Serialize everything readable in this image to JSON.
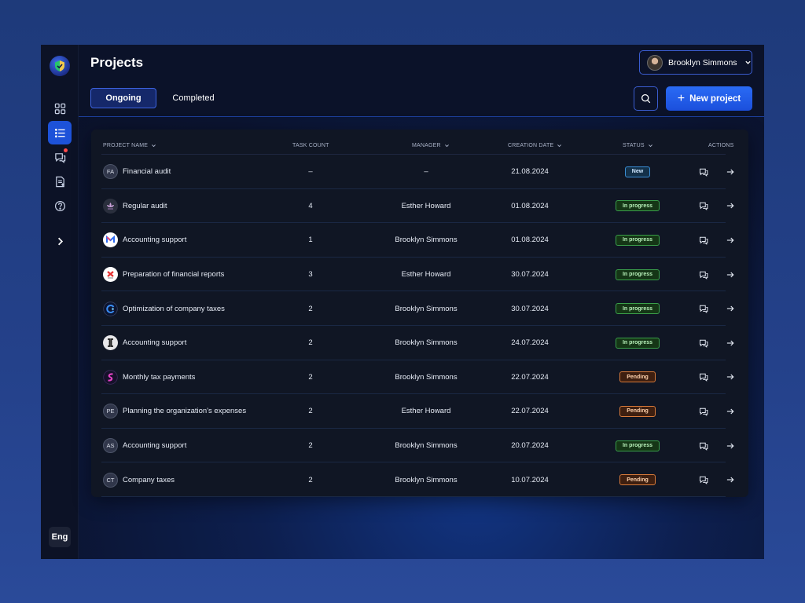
{
  "app": {
    "page_title": "Projects",
    "language": "Eng",
    "user": {
      "name": "Brooklyn Simmons"
    }
  },
  "sidebar": {
    "icons": [
      "dashboard-icon",
      "list-icon",
      "chat-icon",
      "document-add-icon",
      "help-icon",
      "chevron-right-icon"
    ]
  },
  "tabs": [
    {
      "label": "Ongoing",
      "active": true
    },
    {
      "label": "Completed",
      "active": false
    }
  ],
  "toolbar": {
    "new_project_label": "New project"
  },
  "table": {
    "headers": {
      "project_name": "PROJECT NAME",
      "task_count": "TASK COUNT",
      "manager": "MANAGER",
      "creation_date": "CREATION DATE",
      "status": "STATUS",
      "actions": "ACTIONS"
    },
    "rows": [
      {
        "icon": "initials",
        "initials": "FA",
        "name": "Financial audit",
        "tasks": "–",
        "manager": "–",
        "date": "21.08.2024",
        "status": "New",
        "status_type": "new"
      },
      {
        "icon": "lotus",
        "initials": "",
        "name": "Regular audit",
        "tasks": "4",
        "manager": "Esther Howard",
        "date": "01.08.2024",
        "status": "In progress",
        "status_type": "progress"
      },
      {
        "icon": "m-logo",
        "initials": "",
        "name": "Accounting support",
        "tasks": "1",
        "manager": "Brooklyn Simmons",
        "date": "01.08.2024",
        "status": "In progress",
        "status_type": "progress"
      },
      {
        "icon": "x-logo",
        "initials": "",
        "name": "Preparation of financial reports",
        "tasks": "3",
        "manager": "Esther Howard",
        "date": "30.07.2024",
        "status": "In progress",
        "status_type": "progress"
      },
      {
        "icon": "arc-logo",
        "initials": "",
        "name": "Optimization of company taxes",
        "tasks": "2",
        "manager": "Brooklyn Simmons",
        "date": "30.07.2024",
        "status": "In progress",
        "status_type": "progress"
      },
      {
        "icon": "bracket-logo",
        "initials": "",
        "name": "Accounting support",
        "tasks": "2",
        "manager": "Brooklyn Simmons",
        "date": "24.07.2024",
        "status": "In progress",
        "status_type": "progress"
      },
      {
        "icon": "s-logo",
        "initials": "",
        "name": "Monthly tax payments",
        "tasks": "2",
        "manager": "Brooklyn Simmons",
        "date": "22.07.2024",
        "status": "Pending",
        "status_type": "pending"
      },
      {
        "icon": "initials",
        "initials": "PE",
        "name": "Planning the organization's expenses",
        "tasks": "2",
        "manager": "Esther Howard",
        "date": "22.07.2024",
        "status": "Pending",
        "status_type": "pending"
      },
      {
        "icon": "initials",
        "initials": "AS",
        "name": "Accounting support",
        "tasks": "2",
        "manager": "Brooklyn Simmons",
        "date": "20.07.2024",
        "status": "In progress",
        "status_type": "progress"
      },
      {
        "icon": "initials",
        "initials": "CT",
        "name": "Company taxes",
        "tasks": "2",
        "manager": "Brooklyn Simmons",
        "date": "10.07.2024",
        "status": "Pending",
        "status_type": "pending"
      }
    ]
  },
  "colors": {
    "accent": "#1d52d9",
    "new": "#3a8ed6",
    "in_progress": "#3aa04a",
    "pending": "#d87a3a"
  }
}
